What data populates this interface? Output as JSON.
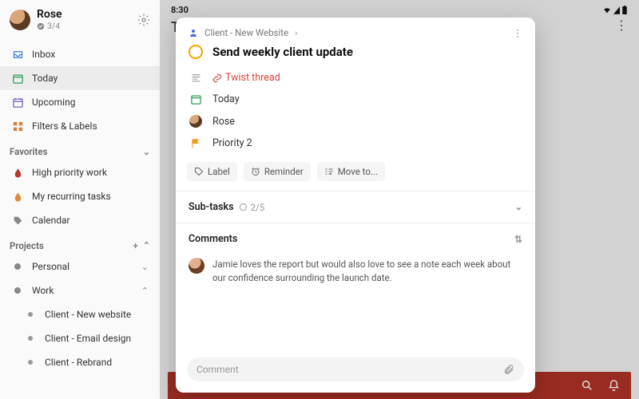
{
  "statusbar": {
    "time": "8:30"
  },
  "user": {
    "name": "Rose",
    "progress": "3/4"
  },
  "nav": {
    "inbox": "Inbox",
    "today": "Today",
    "upcoming": "Upcoming",
    "filters": "Filters & Labels"
  },
  "favorites": {
    "header": "Favorites",
    "items": [
      "High priority work",
      "My recurring tasks",
      "Calendar"
    ]
  },
  "projects": {
    "header": "Projects",
    "personal": "Personal",
    "work": "Work",
    "work_children": [
      "Client - New website",
      "Client - Email design",
      "Client - Rebrand"
    ]
  },
  "backdrop": {
    "title_peek": "T"
  },
  "modal": {
    "breadcrumb": "Client - New Website",
    "title": "Send weekly client update",
    "twist": "Twist thread",
    "date": "Today",
    "assignee": "Rose",
    "priority": "Priority 2",
    "actions": {
      "label": "Label",
      "reminder": "Reminder",
      "move": "Move to..."
    },
    "subtasks": {
      "header": "Sub-tasks",
      "count": "2/5"
    },
    "comments": {
      "header": "Comments",
      "body": "Jamie loves the report but would also love to see a note each week about our confidence surrounding the launch date."
    },
    "composer_placeholder": "Comment"
  }
}
